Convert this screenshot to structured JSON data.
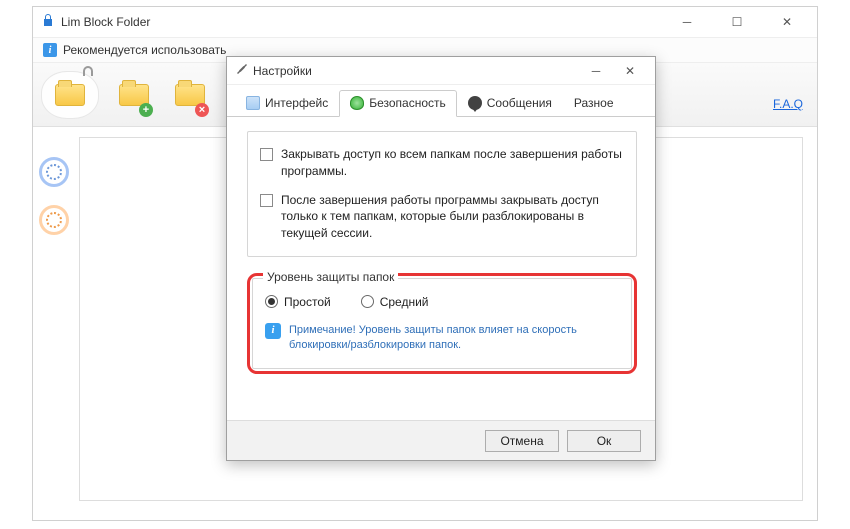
{
  "main_window": {
    "title": "Lim Block Folder",
    "info_bar": "Рекомендуется использовать",
    "faq": "F.A.Q"
  },
  "settings": {
    "title": "Настройки",
    "tabs": {
      "interface": "Интерфейс",
      "security": "Безопасность",
      "messages": "Сообщения",
      "other": "Разное"
    },
    "options": {
      "close_all": "Закрывать доступ ко всем папкам после завершения работы программы.",
      "close_session": "После завершения работы программы закрывать доступ только к тем папкам, которые были разблокированы в текущей сессии."
    },
    "level": {
      "legend": "Уровень защиты папок",
      "simple": "Простой",
      "medium": "Средний",
      "note": "Примечание! Уровень защиты папок влияет на скорость блокировки/разблокировки папок."
    },
    "buttons": {
      "cancel": "Отмена",
      "ok": "Ок"
    }
  }
}
